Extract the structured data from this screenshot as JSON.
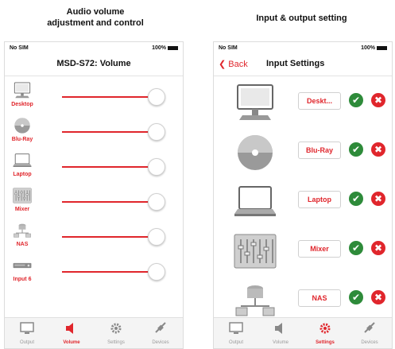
{
  "captions": {
    "left": "Audio volume\nadjustment and control",
    "right": "Input & output setting"
  },
  "status_bar": {
    "carrier": "No SIM",
    "right": "100%"
  },
  "volume_screen": {
    "title": "MSD-S72: Volume",
    "devices": [
      {
        "label": "Desktop",
        "icon": "desktop-icon",
        "level": 1.0
      },
      {
        "label": "Blu-Ray",
        "icon": "disc-icon",
        "level": 1.0
      },
      {
        "label": "Laptop",
        "icon": "laptop-icon",
        "level": 1.0
      },
      {
        "label": "Mixer",
        "icon": "mixer-icon",
        "level": 1.0
      },
      {
        "label": "NAS",
        "icon": "nas-icon",
        "level": 1.0
      },
      {
        "label": "Input 6",
        "icon": "device-box-icon",
        "level": 1.0
      }
    ]
  },
  "input_screen": {
    "back_label": "Back",
    "title": "Input Settings",
    "inputs": [
      {
        "value": "Deskt...",
        "icon": "desktop-icon"
      },
      {
        "value": "Blu-Ray",
        "icon": "disc-icon"
      },
      {
        "value": "Laptop",
        "icon": "laptop-icon"
      },
      {
        "value": "Mixer",
        "icon": "mixer-icon"
      },
      {
        "value": "NAS",
        "icon": "nas-icon"
      }
    ]
  },
  "tabs": [
    {
      "label": "Output",
      "icon": "monitor-icon"
    },
    {
      "label": "Volume",
      "icon": "speaker-icon"
    },
    {
      "label": "Settings",
      "icon": "gear-icon"
    },
    {
      "label": "Devices",
      "icon": "plug-icon"
    }
  ],
  "colors": {
    "accent": "#e0262c",
    "confirm": "#2e8b3a"
  }
}
